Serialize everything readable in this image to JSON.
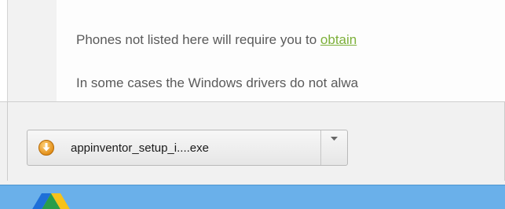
{
  "page": {
    "line1_text": "Phones not listed here will require you to ",
    "line1_link": "obtain",
    "line2_text": "In some cases the Windows drivers do not alwa"
  },
  "download_shelf": {
    "item": {
      "filename": "appinventor_setup_i....exe",
      "icon": "download-warning-icon",
      "dropdown_icon": "chevron-down-icon"
    }
  },
  "taskbar": {
    "pinned_app_icon": "google-drive-icon"
  },
  "colors": {
    "link": "#7db03a",
    "taskbar": "#6ab0ea",
    "download_icon": "#f0a020"
  }
}
